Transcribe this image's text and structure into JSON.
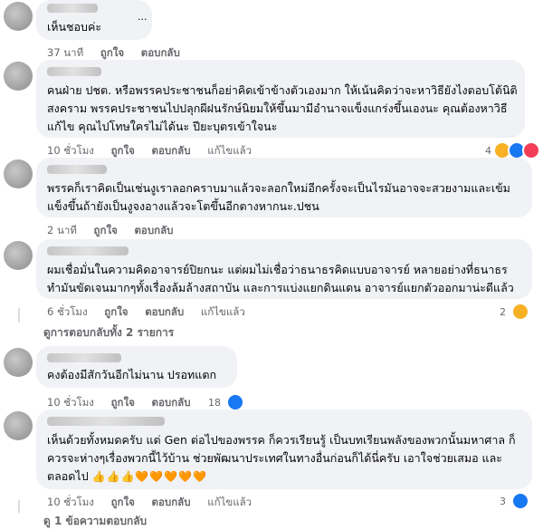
{
  "comments": [
    {
      "text_lines": [
        "เห็นชอบค่ะ"
      ],
      "extra": "...",
      "time": "37 นาที",
      "like": "ถูกใจ",
      "reply": "ตอบกลับ"
    },
    {
      "text_lines": [
        "คนฝ่าย ปชต. หรือพรรคประชาชนก็อย่าคิดเข้าข้างตัวเองมาก ให้เน้นคิดว่าจะหาวิธียังไงตอบโต้นิติ",
        "สงคราม พรรคประชาชนไปปลุกผีฝนรักษ์นิยมให้ขึ้นมามีอำนาจแข็งแกร่งขึ้นเองนะ คุณต้องหาวิธี",
        "แก้ไข คุณไปโทษใครไม่ได้นะ ปียะบุตรเข้าใจนะ"
      ],
      "time": "10 ชั่วโมง",
      "like": "ถูกใจ",
      "reply": "ตอบกลับ",
      "edited": "แก้ไขแล้ว",
      "reaction_count": "4",
      "reaction_icons": [
        "haha-icon",
        "like-icon",
        "love-icon"
      ]
    },
    {
      "text_lines": [
        "พรรคก็เราคิดเป็นเช่นงูเราลอกคราบมาแล้วจะลอกใหม่อีกครั้งจะเป็นไรมันอาจจะสวยงามและเข้ม",
        "แข็งขึ้นถ้ายังเป็นงูจงอางแล้วจะโตขึ้นอีกตางหากนะ.ปชน"
      ],
      "time": "2 นาที",
      "like": "ถูกใจ",
      "reply": "ตอบกลับ"
    },
    {
      "text_lines": [
        "ผมเชื่อมั่นในความคิดอาจารย์ปิยกนะ แต่ผมไม่เชื่อว่าธนาธรคิดแบบอาจารย์ หลายอย่างที่ธนาธร",
        "ทำมันขัดเจนมากๆทั้งเรื่องล้มล้างสถาบัน และการแบ่งแยกดินแดน อาจารย์แยกตัวออกมาน่ะดีแล้ว"
      ],
      "time": "6 ชั่วโมง",
      "like": "ถูกใจ",
      "reply": "ตอบกลับ",
      "edited": "แก้ไขแล้ว",
      "reaction_count": "2",
      "reaction_icons": [
        "haha-icon"
      ],
      "replies_link": "ดูการตอบกลับทั้ง 2 รายการ"
    },
    {
      "text_lines": [
        "คงต้องมีสักวันอีกไม่นาน ปรอทแตก"
      ],
      "time": "10 ชั่วโมง",
      "like": "ถูกใจ",
      "reply": "ตอบกลับ",
      "reaction_count": "18",
      "reaction_icons": [
        "like-icon"
      ]
    },
    {
      "text_lines": [
        "เห็นด้วยทั้งหมดครับ แต่ Gen ต่อไปของพรรค ก็ควรเรียนรู้ เป็นบทเรียนพลังของพวกนั้นมหาศาล ก็",
        "ควรจะห่างๆเรื่องพวกนี้ไว้บ้าน ช่วยพัฒนาประเทศในทางอื่นก่อนก็ได้นี่ครับ เอาใจช่วยเสมอ และ",
        "ตลอดไป"
      ],
      "emoji_tail": "👍👍👍🧡🧡🧡🧡🧡",
      "time": "10 ชั่วโมง",
      "like": "ถูกใจ",
      "reply": "ตอบกลับ",
      "edited": "แก้ไขแล้ว",
      "reaction_count": "3",
      "reaction_icons": [
        "like-icon"
      ],
      "replies_link": "ดู 1 ข้อความตอบกลับ"
    }
  ],
  "colors": {
    "bubble": "#f0f2f5",
    "meta": "#65676b",
    "like": "#1877f2",
    "haha": "#f7b125",
    "love": "#f33e58"
  }
}
